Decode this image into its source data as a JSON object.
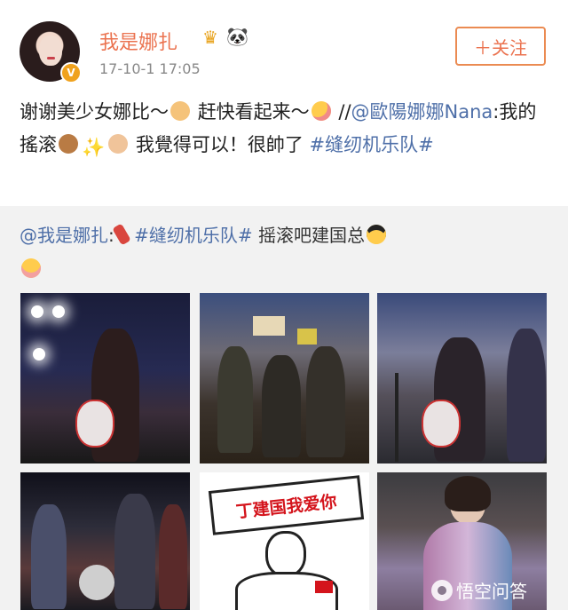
{
  "header": {
    "username": "我是娜扎",
    "crown_icon": "crown-icon",
    "panda_icon": "panda-icon",
    "verified_badge": "V",
    "timestamp": "17-10-1 17:05",
    "follow_label": "＋关注"
  },
  "post": {
    "part1": "谢谢美少女娜比～",
    "part2": "赶快看起来～",
    "part3": "//",
    "mention": "@歐陽娜娜Nana",
    "part4": ":我的搖滚",
    "part5": "我覺得可以！很帥了",
    "hashtag": "#缝纫机乐队#"
  },
  "repost": {
    "mention": "@我是娜扎",
    "colon": ":",
    "hashtag": "#缝纫机乐队#",
    "text": "摇滚吧建国总"
  },
  "photos": {
    "banner_text": "丁建国我爱你",
    "count": 6
  },
  "watermark": {
    "text": "悟空问答"
  },
  "colors": {
    "brand_orange": "#eb7350",
    "link_blue": "#4e6fa8",
    "repost_bg": "#f2f2f2"
  }
}
